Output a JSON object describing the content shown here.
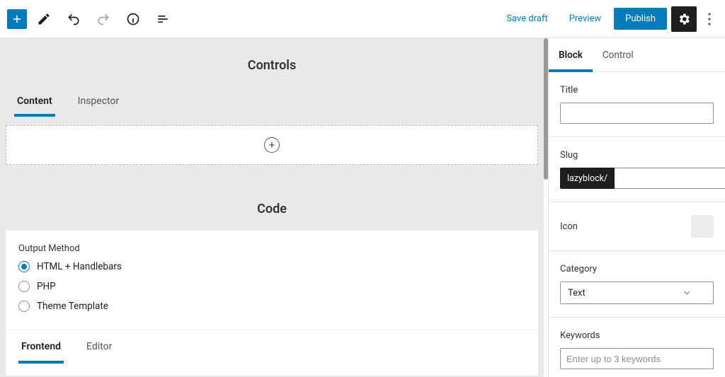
{
  "toolbar": {
    "save_draft": "Save draft",
    "preview": "Preview",
    "publish": "Publish"
  },
  "main": {
    "controls_title": "Controls",
    "tabs": {
      "content": "Content",
      "inspector": "Inspector"
    },
    "code_title": "Code",
    "output_method_label": "Output Method",
    "output_options": {
      "html": "HTML + Handlebars",
      "php": "PHP",
      "theme": "Theme Template"
    },
    "code_tabs": {
      "frontend": "Frontend",
      "editor": "Editor"
    }
  },
  "sidebar": {
    "tabs": {
      "block": "Block",
      "control": "Control"
    },
    "title_label": "Title",
    "title_value": "",
    "slug_label": "Slug",
    "slug_prefix": "lazyblock/",
    "slug_value": "",
    "icon_label": "Icon",
    "category_label": "Category",
    "category_value": "Text",
    "keywords_label": "Keywords",
    "keywords_placeholder": "Enter up to 3 keywords"
  }
}
